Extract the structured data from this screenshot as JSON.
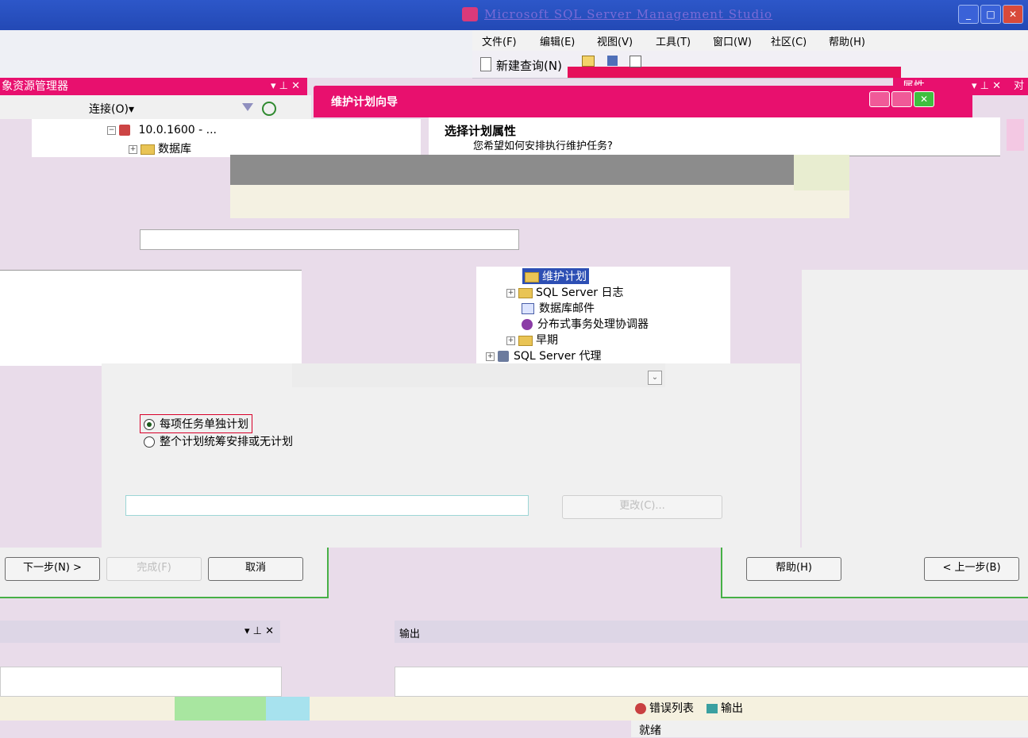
{
  "window": {
    "title": "Microsoft SQL Server Management Studio"
  },
  "menu": [
    {
      "label": "文件(F)"
    },
    {
      "label": "编辑(E)"
    },
    {
      "label": "视图(V)"
    },
    {
      "label": "工具(T)"
    },
    {
      "label": "窗口(W)"
    },
    {
      "label": "社区(C)"
    },
    {
      "label": "帮助(H)"
    }
  ],
  "toolbar": {
    "new_query": "新建查询(N)"
  },
  "object_explorer": {
    "title": "象资源管理器",
    "pin": "▾ ⊥ ✕",
    "connect": "连接(O)▾",
    "server": "10.0.1600 - ...",
    "databases": "数据库"
  },
  "properties_pane": {
    "title": "属性",
    "pin": "▾ ⊥ ✕",
    "tab": "对"
  },
  "wizard": {
    "title": "维护计划向导",
    "heading": "选择计划属性",
    "question": "您希望如何安排执行维护任务?",
    "name_value": "",
    "options": [
      {
        "label": "每项任务单独计划",
        "checked": true
      },
      {
        "label": "整个计划统筹安排或无计划",
        "checked": false
      }
    ],
    "change_button": "更改(C)...",
    "buttons": {
      "help": "帮助(H)",
      "back": "< 上一步(B)",
      "next": "下一步(N) >",
      "finish": "完成(F)",
      "cancel": "取消"
    }
  },
  "tree": [
    {
      "label": "维护计划",
      "type": "folder"
    },
    {
      "label": "SQL Server 日志",
      "type": "folder"
    },
    {
      "label": "数据库邮件",
      "type": "mail"
    },
    {
      "label": "分布式事务处理协调器",
      "type": "dtc"
    },
    {
      "label": "早期",
      "type": "folder"
    },
    {
      "label": "SQL Server 代理",
      "type": "agent"
    }
  ],
  "bottom_left": {
    "pin": "▾ ⊥ ✕"
  },
  "output": {
    "title": "输出"
  },
  "statusbar": {
    "error_list": "错误列表",
    "output_tab": "输出",
    "status": "就绪"
  }
}
